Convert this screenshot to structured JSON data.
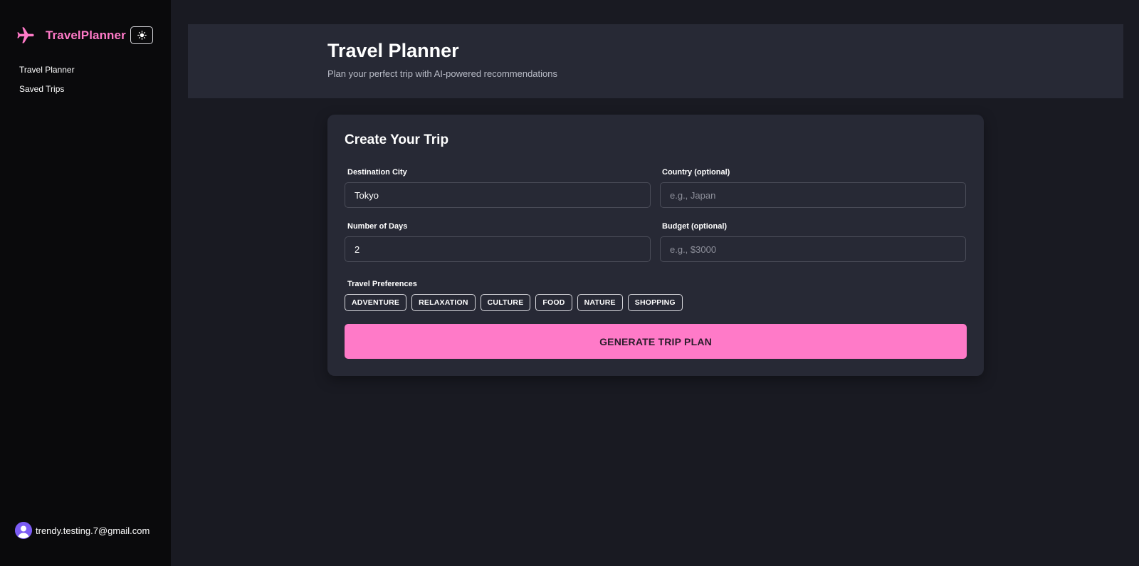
{
  "colors": {
    "accent": "#ff7ac8",
    "sidebar_bg": "#0a0a0c",
    "page_bg": "#191a22",
    "panel_bg": "#272935",
    "avatar": "#7c5cf5"
  },
  "sidebar": {
    "brand_icon": "airplane-icon",
    "brand_name": "TravelPlanner",
    "theme_toggle_icon": "sun-icon",
    "nav": [
      {
        "label": "Travel Planner"
      },
      {
        "label": "Saved Trips"
      }
    ],
    "user": {
      "avatar_icon": "user-avatar-icon",
      "email": "trendy.testing.7@gmail.com"
    }
  },
  "header": {
    "title": "Travel Planner",
    "subtitle": "Plan your perfect trip with AI-powered recommendations"
  },
  "form": {
    "title": "Create Your Trip",
    "destination": {
      "label": "Destination City",
      "value": "Tokyo",
      "placeholder": ""
    },
    "country": {
      "label": "Country (optional)",
      "value": "",
      "placeholder": "e.g., Japan"
    },
    "days": {
      "label": "Number of Days",
      "value": "2",
      "placeholder": ""
    },
    "budget": {
      "label": "Budget (optional)",
      "value": "",
      "placeholder": "e.g., $3000"
    },
    "preferences_label": "Travel Preferences",
    "preferences": [
      "ADVENTURE",
      "RELAXATION",
      "CULTURE",
      "FOOD",
      "NATURE",
      "SHOPPING"
    ],
    "submit_label": "GENERATE TRIP PLAN"
  }
}
